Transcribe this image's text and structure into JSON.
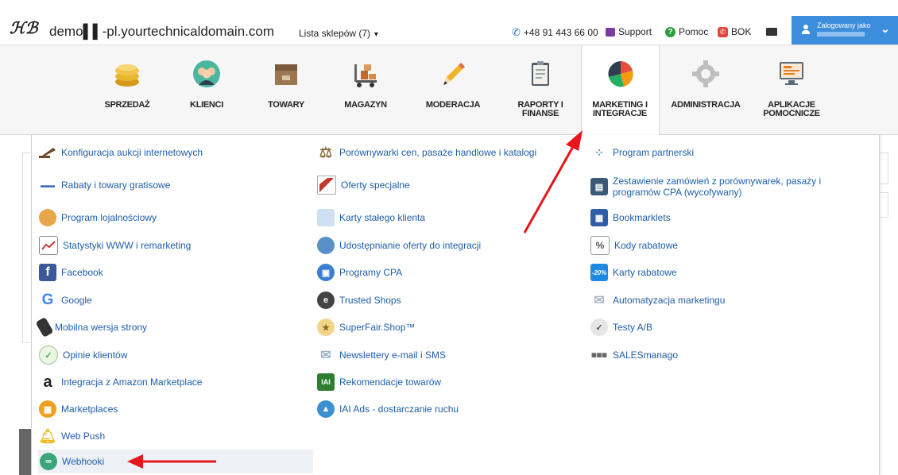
{
  "topbar": {
    "domain": "demo▌▌-pl.yourtechnicaldomain.com",
    "shops": "Lista sklepów (7)",
    "phone": "+48 91 443 66 00",
    "support": "Support",
    "help": "Pomoc",
    "bok": "BOK",
    "user_label": "Zalogowany jako"
  },
  "nav": [
    {
      "label": "SPRZEDAŻ",
      "icon": "coins-icon"
    },
    {
      "label": "KLIENCI",
      "icon": "people-icon"
    },
    {
      "label": "TOWARY",
      "icon": "box-icon"
    },
    {
      "label": "MAGAZYN",
      "icon": "forklift-icon"
    },
    {
      "label": "MODERACJA",
      "icon": "pencil-icon"
    },
    {
      "label": "RAPORTY I FINANSE",
      "icon": "clipboard-icon"
    },
    {
      "label": "MARKETING I INTEGRACJE",
      "icon": "pie-chart-icon"
    },
    {
      "label": "ADMINISTRACJA",
      "icon": "gear-icon"
    },
    {
      "label": "APLIKACJE POMOCNICZE",
      "icon": "monitor-icon"
    }
  ],
  "menu": {
    "col1": [
      {
        "label": "Konfiguracja aukcji internetowych",
        "icon": "gavel-icon",
        "color": "#6b4a2b"
      },
      {
        "label": "Rabaty i towary gratisowe",
        "icon": "discount-icon",
        "color": "#3f6fb5"
      },
      {
        "label": "Program lojalnościowy",
        "icon": "loyalty-icon",
        "color": "#e39a3b"
      },
      {
        "label": "Statystyki WWW i remarketing",
        "icon": "stats-icon",
        "color": "#c23b3b"
      },
      {
        "label": "Facebook",
        "icon": "facebook-icon",
        "color": "#3b5998"
      },
      {
        "label": "Google",
        "icon": "google-icon",
        "color": "#4285f4"
      },
      {
        "label": "Mobilna wersja strony",
        "icon": "mobile-icon",
        "color": "#333333"
      },
      {
        "label": "Opinie klientów",
        "icon": "opinion-icon",
        "color": "#4caf50"
      },
      {
        "label": "Integracja z Amazon Marketplace",
        "icon": "amazon-icon",
        "color": "#222222"
      },
      {
        "label": "Marketplaces",
        "icon": "marketplaces-icon",
        "color": "#f0a020"
      },
      {
        "label": "Web Push",
        "icon": "bell-icon",
        "color": "#f2b81e"
      },
      {
        "label": "Webhooki",
        "icon": "webhook-icon",
        "color": "#3aa67a"
      }
    ],
    "col2": [
      {
        "label": "Porównywarki cen, pasaże handlowe i katalogi",
        "icon": "scales-icon",
        "color": "#8a6d3b"
      },
      {
        "label": "Oferty specjalne",
        "icon": "special-offer-icon",
        "color": "#c0392b"
      },
      {
        "label": "Karty stałego klienta",
        "icon": "loyalty-card-icon",
        "color": "#6fa8dc"
      },
      {
        "label": "Udostępnianie oferty do integracji",
        "icon": "share-icon",
        "color": "#5b8fc9"
      },
      {
        "label": "Programy CPA",
        "icon": "cpa-icon",
        "color": "#3b7ed0"
      },
      {
        "label": "Trusted Shops",
        "icon": "trusted-shops-icon",
        "color": "#444444"
      },
      {
        "label": "SuperFair.Shop™",
        "icon": "superfair-icon",
        "color": "#d2a13a"
      },
      {
        "label": "Newslettery e-mail i SMS",
        "icon": "newsletter-icon",
        "color": "#9bb3c9"
      },
      {
        "label": "Rekomendacje towarów",
        "icon": "recommendations-icon",
        "color": "#2e7d32"
      },
      {
        "label": "IAI Ads - dostarczanie ruchu",
        "icon": "ads-icon",
        "color": "#3d8fd1"
      }
    ],
    "col3": [
      {
        "label": "Program partnerski",
        "icon": "partner-icon",
        "color": "#5d8fc9"
      },
      {
        "label": "Zestawienie zamówień z porównywarek, pasaży i programów CPA (wycofywany)",
        "icon": "orders-summary-icon",
        "color": "#3b5a7a"
      },
      {
        "label": "Bookmarklets",
        "icon": "bookmarklets-icon",
        "color": "#2f5da8"
      },
      {
        "label": "Kody rabatowe",
        "icon": "percent-icon",
        "color": "#777777"
      },
      {
        "label": "Karty rabatowe",
        "icon": "discount-card-icon",
        "color": "#1e88e5"
      },
      {
        "label": "Automatyzacja marketingu",
        "icon": "automation-icon",
        "color": "#a8b5c2"
      },
      {
        "label": "Testy A/B",
        "icon": "ab-test-icon",
        "color": "#666666"
      },
      {
        "label": "SALESmanago",
        "icon": "salesmanago-icon",
        "color": "#555555"
      }
    ]
  },
  "colors": {
    "link": "#1f5ea8",
    "arrow": "#e8151b",
    "user_bg": "#3c8ddc"
  }
}
